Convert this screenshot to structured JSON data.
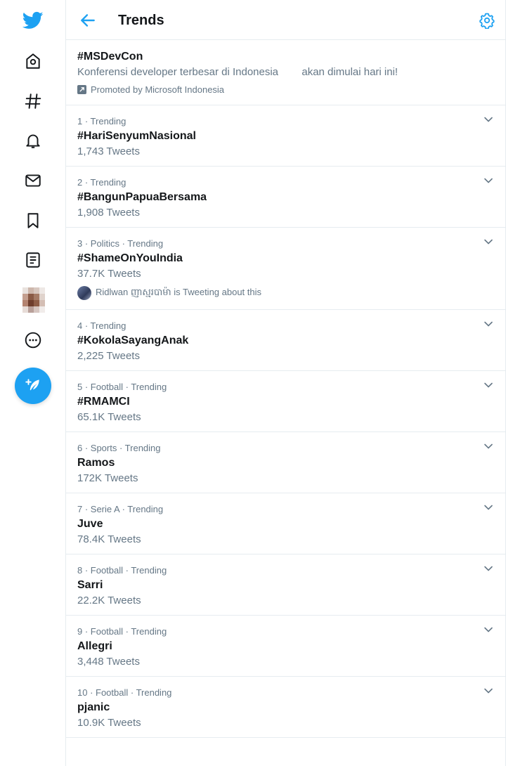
{
  "header": {
    "title": "Trends"
  },
  "promoted": {
    "title": "#MSDevCon",
    "description": "Konferensi developer terbesar di Indonesia        akan dimulai hari ini!",
    "promoted_by": "Promoted by Microsoft Indonesia"
  },
  "trends": [
    {
      "meta": "1 · Trending",
      "name": "#HariSenyumNasional",
      "count": "1,743 Tweets"
    },
    {
      "meta": "2 · Trending",
      "name": "#BangunPapuaBersama",
      "count": "1,908 Tweets"
    },
    {
      "meta": "3 · Politics · Trending",
      "name": "#ShameOnYouIndia",
      "count": "37.7K Tweets",
      "tweeting": "Ridlwan ញាស្មរបាម៉ា is Tweeting about this"
    },
    {
      "meta": "4 · Trending",
      "name": "#KokolaSayangAnak",
      "count": "2,225 Tweets"
    },
    {
      "meta": "5 · Football · Trending",
      "name": "#RMAMCI",
      "count": "65.1K Tweets"
    },
    {
      "meta": "6 · Sports · Trending",
      "name": "Ramos",
      "count": "172K Tweets"
    },
    {
      "meta": "7 · Serie A · Trending",
      "name": "Juve",
      "count": "78.4K Tweets"
    },
    {
      "meta": "8 · Football · Trending",
      "name": "Sarri",
      "count": "22.2K Tweets"
    },
    {
      "meta": "9 · Football · Trending",
      "name": "Allegri",
      "count": "3,448 Tweets"
    },
    {
      "meta": "10 · Football · Trending",
      "name": "pjanic",
      "count": "10.9K Tweets"
    }
  ],
  "colors": {
    "accent": "#1da1f2",
    "text": "#14171a",
    "muted": "#657786",
    "border": "#e6ecf0"
  },
  "icons": {
    "sidebar": [
      "twitter-logo-icon",
      "home-icon",
      "explore-hashtag-icon",
      "notifications-bell-icon",
      "messages-envelope-icon",
      "bookmarks-icon",
      "lists-icon",
      "profile-avatar",
      "more-icon",
      "compose-tweet-icon"
    ],
    "header": [
      "back-arrow-icon",
      "settings-gear-icon"
    ]
  }
}
